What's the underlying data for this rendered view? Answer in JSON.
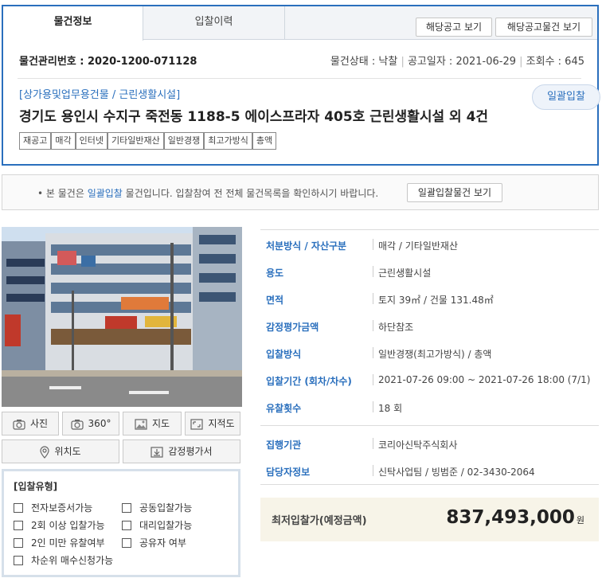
{
  "tabs": {
    "active": "물건정보",
    "inactive": "입찰이력"
  },
  "header_buttons": {
    "notice": "해당공고 보기",
    "notice_items": "해당공고물건 보기"
  },
  "info": {
    "mgmt_no": "물건관리번호 : 2020-1200-071128",
    "status": "물건상태 : 낙찰",
    "notice_date": "공고일자 : 2021-06-29",
    "views": "조회수 : 645"
  },
  "category": "[상가용및업무용건물 / 근린생활시설]",
  "title": "경기도 용인시 수지구 죽전동 1188-5 에이스프라자 405호 근린생활시설 외 4건",
  "bulk_pill": "일괄입찰",
  "tags": [
    "재공고",
    "매각",
    "인터넷",
    "기타일반재산",
    "일반경쟁",
    "최고가방식",
    "총액"
  ],
  "notice": {
    "prefix": "• 본 물건은 ",
    "highlight": "일괄입찰",
    "suffix": " 물건입니다. 입찰참여 전 전체 물건목록을 확인하시기 바랍니다.",
    "button": "일괄입찰물건 보기"
  },
  "photo_buttons": {
    "photo": "사진",
    "pano": "360°",
    "map": "지도",
    "cadastral": "지적도",
    "location": "위치도",
    "appraisal": "감정평가서"
  },
  "bid_type": {
    "title": "[입찰유형]",
    "options": [
      "전자보증서가능",
      "공동입찰가능",
      "2회 이상 입찰가능",
      "대리입찰가능",
      "2인 미만 유찰여부",
      "공유자 여부",
      "차순위 매수신청가능"
    ]
  },
  "details": [
    {
      "label": "처분방식 / 자산구분",
      "value": "매각 / 기타일반재산"
    },
    {
      "label": "용도",
      "value": "근린생활시설"
    },
    {
      "label": "면적",
      "value": "토지 39㎡ / 건물 131.48㎡"
    },
    {
      "label": "감정평가금액",
      "value": "하단참조"
    },
    {
      "label": "입찰방식",
      "value": "일반경쟁(최고가방식) / 총액"
    },
    {
      "label": "입찰기간 (회차/차수)",
      "value": "2021-07-26 09:00 ~ 2021-07-26 18:00 (7/1)"
    },
    {
      "label": "유찰횟수",
      "value": "18 회"
    },
    {
      "label": "집행기관",
      "value": "코리아신탁주식회사"
    },
    {
      "label": "담당자정보",
      "value": "신탁사업팀 / 빙범준 / 02-3430-2064"
    }
  ],
  "min_bid": {
    "label": "최저입찰가(예정금액)",
    "value": "837,493,000",
    "unit": "원"
  },
  "colors": {
    "accent": "#2a6fbd",
    "min_bid_bg": "#f7f4e8"
  }
}
